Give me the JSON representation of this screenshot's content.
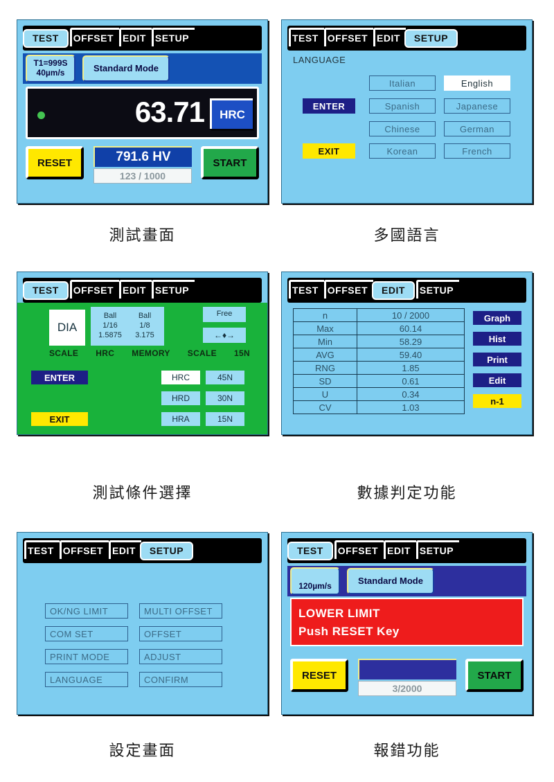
{
  "tabs": [
    "TEST",
    "OFFSET",
    "EDIT",
    "SETUP"
  ],
  "panels": {
    "test": {
      "caption": "測試畫面",
      "active_tab": "TEST",
      "t1_line1": "T1=999S",
      "t1_line2": "40µm/s",
      "mode": "Standard Mode",
      "value": "63.71",
      "scale": "HRC",
      "reset_label": "RESET",
      "start_label": "START",
      "converted": "791.6 HV",
      "count": "123 / 1000"
    },
    "language": {
      "caption": "多國語言",
      "active_tab": "SETUP",
      "title": "LANGUAGE",
      "enter_label": "ENTER",
      "exit_label": "EXIT",
      "col_left": [
        "Italian",
        "Spanish",
        "Chinese",
        "Korean"
      ],
      "col_right": [
        "English",
        "Japanese",
        "German",
        "French"
      ],
      "selected": "English"
    },
    "conditions": {
      "caption": "測試條件選擇",
      "active_tab": "TEST",
      "indenter": "DIA",
      "ball1_l1": "Ball",
      "ball1_l2": "1/16",
      "ball1_l3": "1.5875",
      "ball2_l1": "Ball",
      "ball2_l2": "1/8",
      "ball2_l3": "3.175",
      "free_label": "Free",
      "arrow_label": "←♦→",
      "label_scale": "SCALE",
      "label_scale_val": "HRC",
      "label_memory": "MEMORY",
      "label_scale2": "SCALE",
      "label_force": "15N",
      "enter_label": "ENTER",
      "exit_label": "EXIT",
      "scales": [
        "HRC",
        "HRD",
        "HRA"
      ],
      "forces": [
        "45N",
        "30N",
        "15N"
      ],
      "selected_scale": "HRC"
    },
    "statistics": {
      "caption": "數據判定功能",
      "active_tab": "EDIT",
      "side_buttons": [
        "Graph",
        "Hist",
        "Print",
        "Edit",
        "n-1"
      ],
      "rows": [
        {
          "label": "n",
          "value": "10 / 2000"
        },
        {
          "label": "Max",
          "value": "60.14"
        },
        {
          "label": "Min",
          "value": "58.29"
        },
        {
          "label": "AVG",
          "value": "59.40"
        },
        {
          "label": "RNG",
          "value": "1.85"
        },
        {
          "label": "SD",
          "value": "0.61"
        },
        {
          "label": "U",
          "value": "0.34"
        },
        {
          "label": "CV",
          "value": "1.03"
        }
      ]
    },
    "setup": {
      "caption": "設定畫面",
      "active_tab": "SETUP",
      "col_left": [
        "OK/NG LIMIT",
        "COM SET",
        "PRINT MODE",
        "LANGUAGE"
      ],
      "col_right": [
        "MULTI OFFSET",
        "OFFSET",
        "ADJUST",
        "CONFIRM"
      ]
    },
    "error": {
      "caption": "報錯功能",
      "active_tab": "TEST",
      "speed": "120µm/s",
      "mode": "Standard Mode",
      "message_line1": "LOWER LIMIT",
      "message_line2": "Push RESET Key",
      "reset_label": "RESET",
      "start_label": "START",
      "count": "3/2000"
    }
  },
  "colors": {
    "screen_bg": "#7ecdf0",
    "tabbar_bg": "#000000",
    "tab_active": "#9ddcf4",
    "green_bg": "#19b23b",
    "blue_band": "#1452b4",
    "navy_button": "#1d1f86",
    "yellow_button": "#ffe800",
    "green_button": "#22a84a",
    "error_red": "#ee1c1c"
  }
}
